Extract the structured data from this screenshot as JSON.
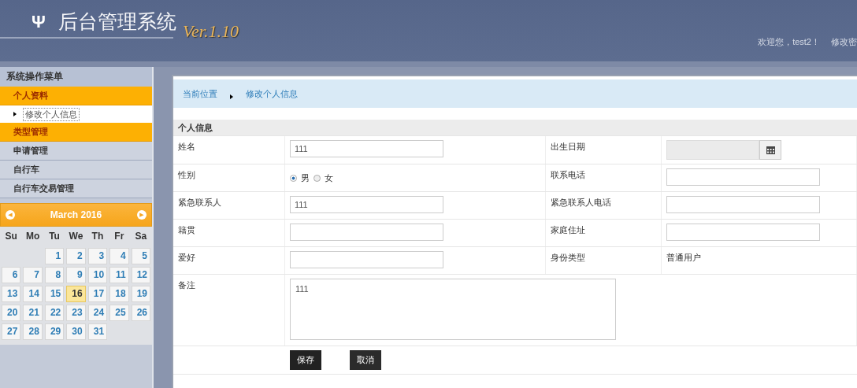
{
  "header": {
    "logo_mark": "Ψ",
    "title": "后台管理系统",
    "version": "Ver.1.10",
    "welcome": "欢迎您，test2！",
    "link": "修改密"
  },
  "sidebar": {
    "title": "系统操作菜单",
    "items": [
      {
        "label": "个人资料",
        "highlighted": true,
        "children": [
          {
            "label": "修改个人信息",
            "selected": true
          }
        ]
      },
      {
        "label": "类型管理",
        "highlighted": true
      },
      {
        "label": "申请管理",
        "highlighted": false
      },
      {
        "label": "自行车",
        "highlighted": false
      },
      {
        "label": "自行车交易管理",
        "highlighted": false
      }
    ]
  },
  "calendar": {
    "prev": "◀",
    "month": "March 2016",
    "next": "▶",
    "weekdays": [
      "Su",
      "Mo",
      "Tu",
      "We",
      "Th",
      "Fr",
      "Sa"
    ],
    "weeks": [
      {
        "kind": "first",
        "days": [
          {
            "day": "1",
            "today": false
          },
          {
            "day": "2",
            "today": false
          },
          {
            "day": "3",
            "today": false
          },
          {
            "day": "4",
            "today": false
          },
          {
            "day": "5",
            "today": false
          }
        ]
      },
      {
        "kind": "full",
        "days": [
          {
            "day": "6",
            "today": false
          },
          {
            "day": "7",
            "today": false
          },
          {
            "day": "8",
            "today": false
          },
          {
            "day": "9",
            "today": false
          },
          {
            "day": "10",
            "today": false
          },
          {
            "day": "11",
            "today": false
          },
          {
            "day": "12",
            "today": false
          }
        ]
      },
      {
        "kind": "full",
        "days": [
          {
            "day": "13",
            "today": false
          },
          {
            "day": "14",
            "today": false
          },
          {
            "day": "15",
            "today": false
          },
          {
            "day": "16",
            "today": true
          },
          {
            "day": "17",
            "today": false
          },
          {
            "day": "18",
            "today": false
          },
          {
            "day": "19",
            "today": false
          }
        ]
      },
      {
        "kind": "full",
        "days": [
          {
            "day": "20",
            "today": false
          },
          {
            "day": "21",
            "today": false
          },
          {
            "day": "22",
            "today": false
          },
          {
            "day": "23",
            "today": false
          },
          {
            "day": "24",
            "today": false
          },
          {
            "day": "25",
            "today": false
          },
          {
            "day": "26",
            "today": false
          }
        ]
      },
      {
        "kind": "last",
        "days": [
          {
            "day": "27",
            "today": false
          },
          {
            "day": "28",
            "today": false
          },
          {
            "day": "29",
            "today": false
          },
          {
            "day": "30",
            "today": false
          },
          {
            "day": "31",
            "today": false
          }
        ]
      }
    ]
  },
  "breadcrumb": {
    "label": "当前位置",
    "current": "修改个人信息"
  },
  "form": {
    "title": "个人信息",
    "rows": [
      {
        "left": {
          "label": "姓名",
          "kind": "text",
          "value": "111"
        },
        "right": {
          "label": "出生日期",
          "kind": "date",
          "disabled": true
        }
      },
      {
        "left": {
          "label": "性别",
          "kind": "radio",
          "options": [
            {
              "label": "男",
              "selected": true
            },
            {
              "label": "女",
              "selected": false
            }
          ]
        },
        "right": {
          "label": "联系电话",
          "kind": "text"
        }
      },
      {
        "left": {
          "label": "紧急联系人",
          "kind": "text",
          "value": "111"
        },
        "right": {
          "label": "紧急联系人电话",
          "kind": "text"
        }
      },
      {
        "left": {
          "label": "籍贯",
          "kind": "text"
        },
        "right": {
          "label": "家庭住址",
          "kind": "text"
        }
      },
      {
        "left": {
          "label": "爱好",
          "kind": "text"
        },
        "right": {
          "label": "身份类型",
          "kind": "static",
          "value": "普通用户"
        }
      },
      {
        "left": {
          "label": "备注",
          "kind": "textarea",
          "value": "111"
        }
      }
    ],
    "buttons": [
      {
        "label": "保存",
        "kind": "save"
      },
      {
        "label": "取消",
        "kind": "cancel"
      }
    ]
  }
}
